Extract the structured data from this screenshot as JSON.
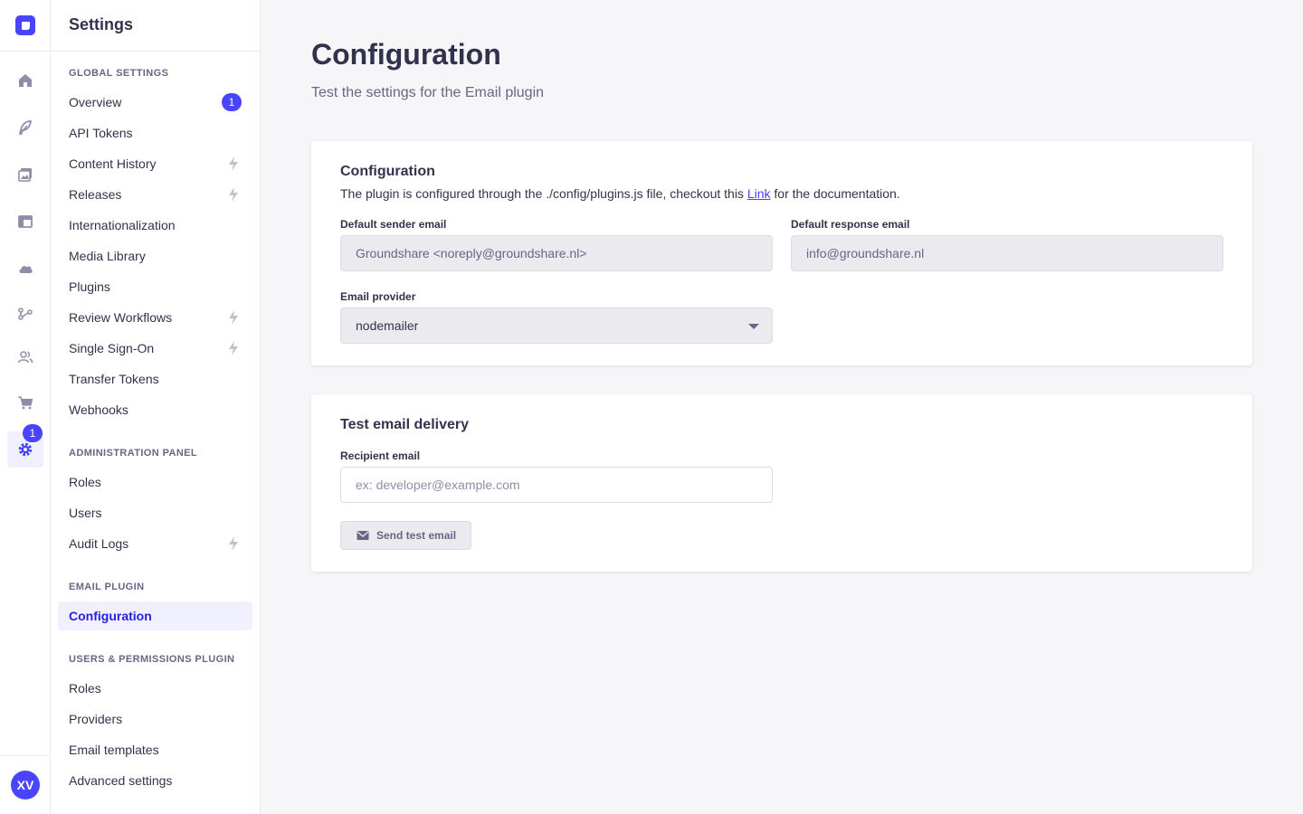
{
  "rail": {
    "badge": "1",
    "avatar_initials": "XV",
    "items": [
      {
        "icon": "house-icon"
      },
      {
        "icon": "feather-icon"
      },
      {
        "icon": "images-icon"
      },
      {
        "icon": "layout-icon"
      },
      {
        "icon": "cloud-icon"
      },
      {
        "icon": "workflow-icon"
      },
      {
        "icon": "users-icon"
      },
      {
        "icon": "cart-icon"
      },
      {
        "icon": "cog-icon"
      }
    ]
  },
  "subnav": {
    "title": "Settings",
    "sections": {
      "global": "GLOBAL SETTINGS",
      "admin": "ADMINISTRATION PANEL",
      "email": "EMAIL PLUGIN",
      "users_perm": "USERS & PERMISSIONS PLUGIN"
    },
    "items": {
      "overview": "Overview",
      "overview_count": "1",
      "api_tokens": "API Tokens",
      "content_history": "Content History",
      "releases": "Releases",
      "i18n": "Internationalization",
      "media_library": "Media Library",
      "plugins": "Plugins",
      "review_workflows": "Review Workflows",
      "sso": "Single Sign-On",
      "transfer_tokens": "Transfer Tokens",
      "webhooks": "Webhooks",
      "roles": "Roles",
      "users": "Users",
      "audit_logs": "Audit Logs",
      "configuration": "Configuration",
      "up_roles": "Roles",
      "providers": "Providers",
      "email_templates": "Email templates",
      "advanced_settings": "Advanced settings"
    }
  },
  "main": {
    "title": "Configuration",
    "subtitle": "Test the settings for the Email plugin",
    "config_card": {
      "title": "Configuration",
      "desc_before": "The plugin is configured through the ./config/plugins.js file, checkout this ",
      "desc_link": "Link",
      "desc_after": " for the documentation.",
      "sender_label": "Default sender email",
      "sender_value": "Groundshare <noreply@groundshare.nl>",
      "response_label": "Default response email",
      "response_value": "info@groundshare.nl",
      "provider_label": "Email provider",
      "provider_value": "nodemailer"
    },
    "test_card": {
      "title": "Test email delivery",
      "recipient_label": "Recipient email",
      "recipient_placeholder": "ex: developer@example.com",
      "send_label": "Send test email"
    }
  },
  "colors": {
    "primary": "#4945ff",
    "active_text": "#271fe0",
    "active_bg": "#f0f0ff",
    "page_bg": "#f6f6f9"
  }
}
